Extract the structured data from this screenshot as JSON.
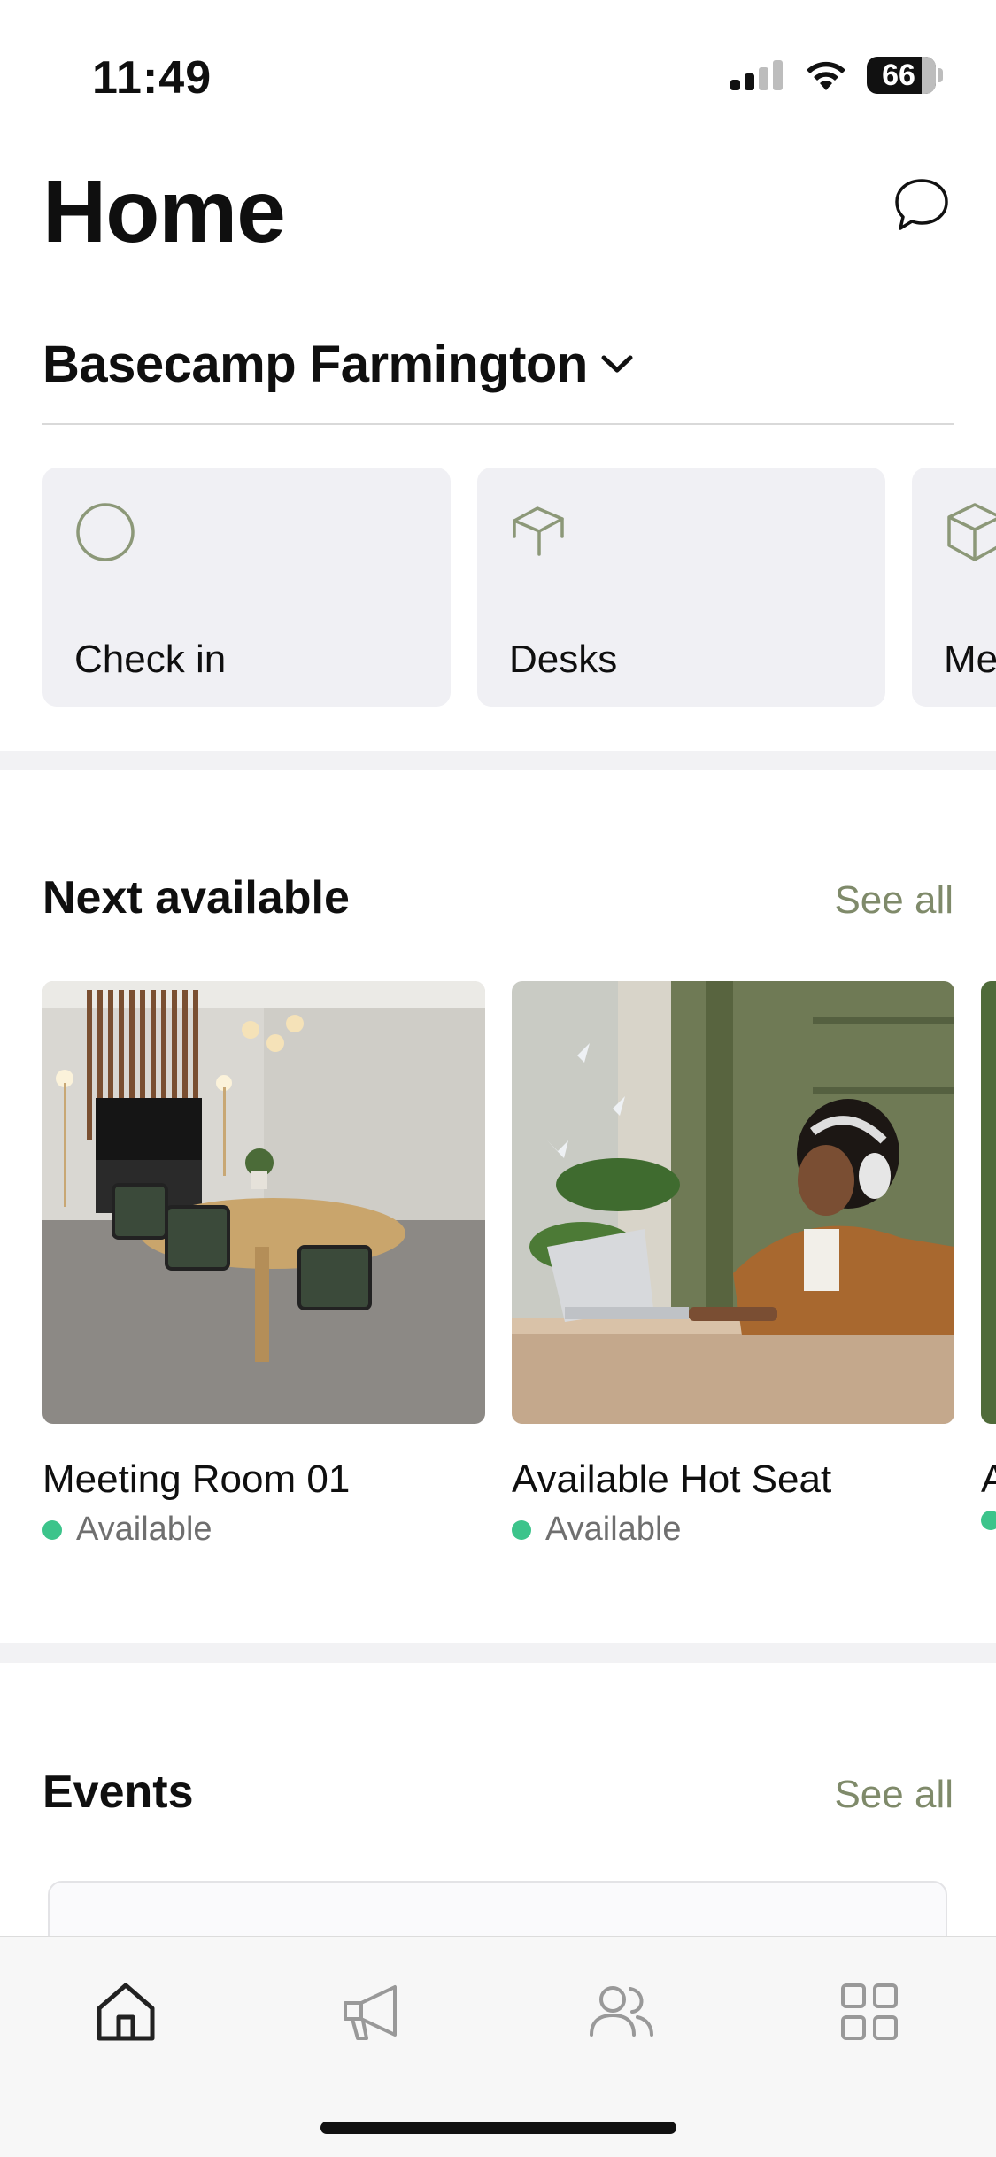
{
  "status_bar": {
    "time": "11:49",
    "battery": "66",
    "icons": [
      "signal-icon",
      "wifi-icon",
      "battery-icon"
    ]
  },
  "header": {
    "title": "Home",
    "action_icon": "chat-bubble-icon"
  },
  "location": {
    "name": "Basecamp Farmington",
    "icon": "chevron-down-icon"
  },
  "quick_actions": [
    {
      "label": "Check in",
      "icon": "circle-icon"
    },
    {
      "label": "Desks",
      "icon": "box-open-icon"
    },
    {
      "label": "Me",
      "icon": "cube-icon"
    }
  ],
  "next_available": {
    "title": "Next available",
    "see_all": "See all",
    "items": [
      {
        "name": "Meeting Room 01",
        "status": "Available",
        "image": "meeting-room-photo"
      },
      {
        "name": "Available Hot Seat",
        "status": "Available",
        "image": "hot-seat-photo"
      },
      {
        "name": "A",
        "status": "",
        "image": "partial-photo"
      }
    ]
  },
  "events": {
    "title": "Events",
    "see_all": "See all"
  },
  "tab_bar": {
    "tabs": [
      {
        "icon": "home-icon",
        "active": true
      },
      {
        "icon": "megaphone-icon",
        "active": false
      },
      {
        "icon": "people-icon",
        "active": false
      },
      {
        "icon": "grid-icon",
        "active": false
      }
    ]
  },
  "colors": {
    "accent": "#7f8a6a",
    "icon_green": "#8c9878",
    "status_available": "#3cc48b",
    "card_bg": "#f0f0f4"
  }
}
